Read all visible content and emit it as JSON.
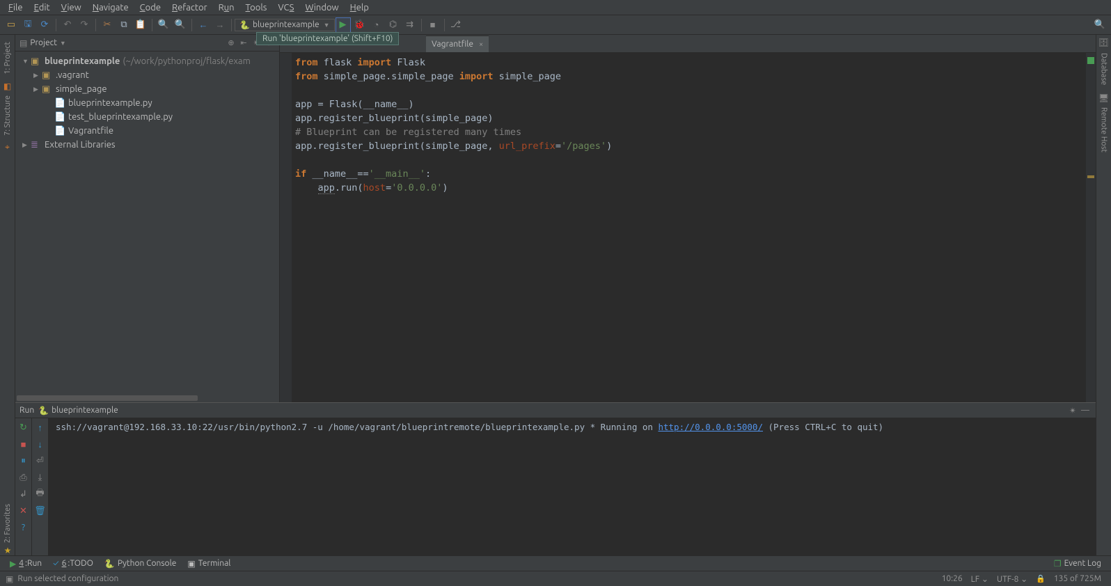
{
  "menu": [
    "File",
    "Edit",
    "View",
    "Navigate",
    "Code",
    "Refactor",
    "Run",
    "Tools",
    "VCS",
    "Window",
    "Help"
  ],
  "run_config": {
    "name": "blueprintexample"
  },
  "tooltip": "Run 'blueprintexample' (Shift+F10)",
  "project": {
    "title": "Project",
    "root": {
      "name": "blueprintexample",
      "path": "(~/work/pythonproj/flask/exam"
    },
    "items": [
      {
        "type": "folder",
        "name": ".vagrant"
      },
      {
        "type": "folder",
        "name": "simple_page"
      },
      {
        "type": "py",
        "name": "blueprintexample.py"
      },
      {
        "type": "py",
        "name": "test_blueprintexample.py"
      },
      {
        "type": "file",
        "name": "Vagrantfile"
      }
    ],
    "ext_lib": "External Libraries"
  },
  "tabs": [
    {
      "name": "Vagrantfile"
    }
  ],
  "code": {
    "l1a": "from",
    "l1b": " flask ",
    "l1c": "import",
    "l1d": " Flask",
    "l2a": "from",
    "l2b": " simple_page.simple_page ",
    "l2c": "import",
    "l2d": " simple_page",
    "l3": "",
    "l4": "app = Flask(__name__)",
    "l5": "app.register_blueprint(simple_page)",
    "l6": "# Blueprint can be registered many times",
    "l7a": "app.register_blueprint(simple_page, ",
    "l7p": "url_prefix",
    "l7b": "=",
    "l7s": "'/pages'",
    "l7c": ")",
    "l8": "",
    "l9a": "if",
    "l9b": " __name__==",
    "l9s": "'__main__'",
    "l9c": ":",
    "l10a": "    ",
    "l10u": "app",
    "l10b": ".run(",
    "l10p": "host",
    "l10c": "=",
    "l10s": "'0.0.0.0'",
    "l10d": ")"
  },
  "run_panel": {
    "title_prefix": "Run",
    "title_name": "blueprintexample",
    "line1": "ssh://vagrant@192.168.33.10:22/usr/bin/python2.7 -u /home/vagrant/blueprintremote/blueprintexample.py",
    "line2a": " * Running on ",
    "line2_url": "http://0.0.0.0:5000/",
    "line2b": " (Press CTRL+C to quit)"
  },
  "bottom": {
    "run": "Run",
    "run_num": "4",
    "todo": "TODO",
    "todo_num": "6",
    "pyconsole": "Python Console",
    "terminal": "Terminal",
    "eventlog": "Event Log"
  },
  "sidetabs": {
    "project": "1: Project",
    "structure": "7: Structure",
    "favorites": "2: Favorites",
    "database": "Database",
    "remote": "Remote Host"
  },
  "status": {
    "msg": "Run selected configuration",
    "pos": "10:26",
    "le": "LF",
    "enc": "UTF-8",
    "mem": "135 of 725M"
  }
}
